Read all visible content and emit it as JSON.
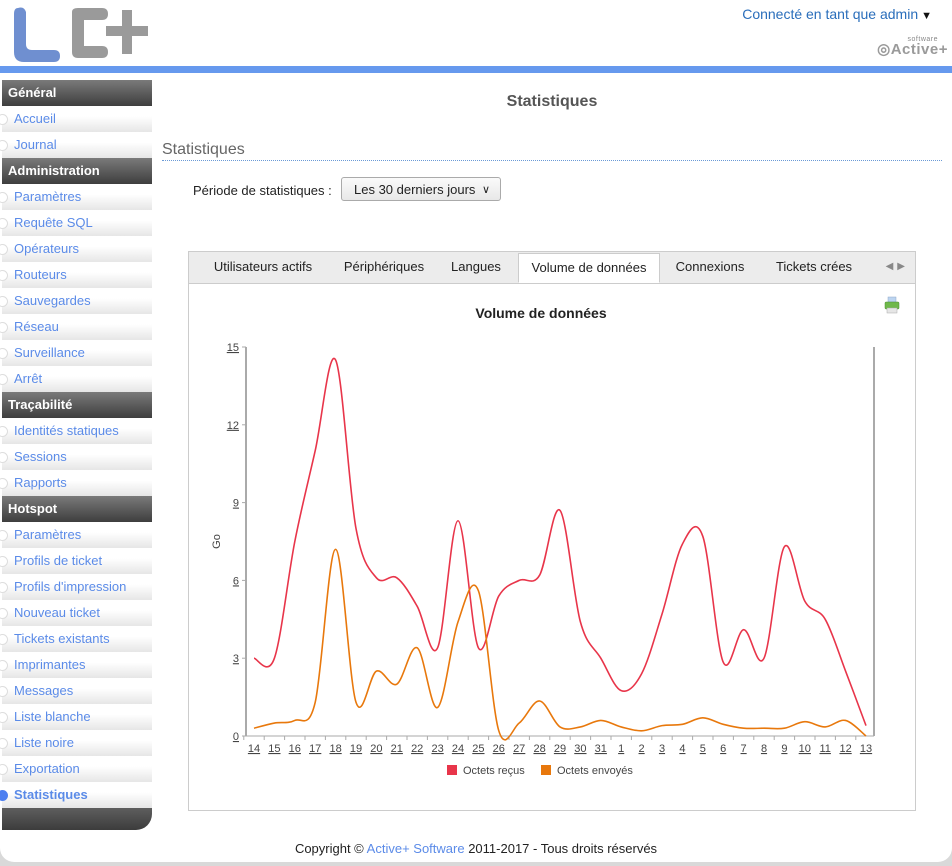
{
  "header": {
    "logo_text": "LC+",
    "user_menu": "Connecté en tant que admin",
    "brand": "Active+",
    "brand_small": "software"
  },
  "sidebar": {
    "sections": [
      {
        "title": "Général",
        "items": [
          "Accueil",
          "Journal"
        ]
      },
      {
        "title": "Administration",
        "items": [
          "Paramètres",
          "Requête SQL",
          "Opérateurs",
          "Routeurs",
          "Sauvegardes",
          "Réseau",
          "Surveillance",
          "Arrêt"
        ]
      },
      {
        "title": "Traçabilité",
        "items": [
          "Identités statiques",
          "Sessions",
          "Rapports"
        ]
      },
      {
        "title": "Hotspot",
        "items": [
          "Paramètres",
          "Profils de ticket",
          "Profils d'impression",
          "Nouveau ticket",
          "Tickets existants",
          "Imprimantes",
          "Messages",
          "Liste blanche",
          "Liste noire",
          "Exportation",
          "Statistiques"
        ]
      }
    ],
    "active_item": "Statistiques"
  },
  "main": {
    "page_title": "Statistiques",
    "section_title": "Statistiques",
    "period_label": "Période de statistiques :",
    "period_value": "Les 30 derniers jours",
    "tabs": [
      "Utilisateurs actifs",
      "Périphériques",
      "Langues",
      "Volume de données",
      "Connexions",
      "Tickets crées"
    ],
    "active_tab": "Volume de données"
  },
  "chart_data": {
    "type": "line",
    "title": "Volume de données",
    "xlabel": "",
    "ylabel": "Go",
    "ylim": [
      0,
      15
    ],
    "yticks": [
      0,
      3,
      6,
      9,
      12,
      15
    ],
    "grid": false,
    "legend_position": "bottom",
    "categories": [
      "14",
      "15",
      "16",
      "17",
      "18",
      "19",
      "20",
      "21",
      "22",
      "23",
      "24",
      "25",
      "26",
      "27",
      "28",
      "29",
      "30",
      "31",
      "1",
      "2",
      "3",
      "4",
      "5",
      "6",
      "7",
      "8",
      "9",
      "10",
      "11",
      "12",
      "13"
    ],
    "series": [
      {
        "name": "Octets reçus",
        "color": "#e8354a",
        "values": [
          3.0,
          3.0,
          7.5,
          11.0,
          14.5,
          8.0,
          6.1,
          6.1,
          5.0,
          3.4,
          8.3,
          3.4,
          5.4,
          6.0,
          6.2,
          8.7,
          4.4,
          3.0,
          1.75,
          2.4,
          4.7,
          7.4,
          7.7,
          2.85,
          4.1,
          3.0,
          7.3,
          5.2,
          4.5,
          2.5,
          0.4
        ]
      },
      {
        "name": "Octets envoyés",
        "color": "#e8780c",
        "values": [
          0.3,
          0.5,
          0.6,
          1.3,
          7.2,
          1.3,
          2.5,
          2.0,
          3.4,
          1.1,
          4.4,
          5.6,
          0.2,
          0.5,
          1.35,
          0.35,
          0.35,
          0.6,
          0.35,
          0.2,
          0.4,
          0.45,
          0.7,
          0.45,
          0.3,
          0.3,
          0.3,
          0.55,
          0.35,
          0.6,
          0.0
        ]
      }
    ]
  },
  "footer": {
    "prefix": "Copyright ©",
    "link": "Active+ Software",
    "suffix": "2011-2017 - Tous droits réservés"
  }
}
